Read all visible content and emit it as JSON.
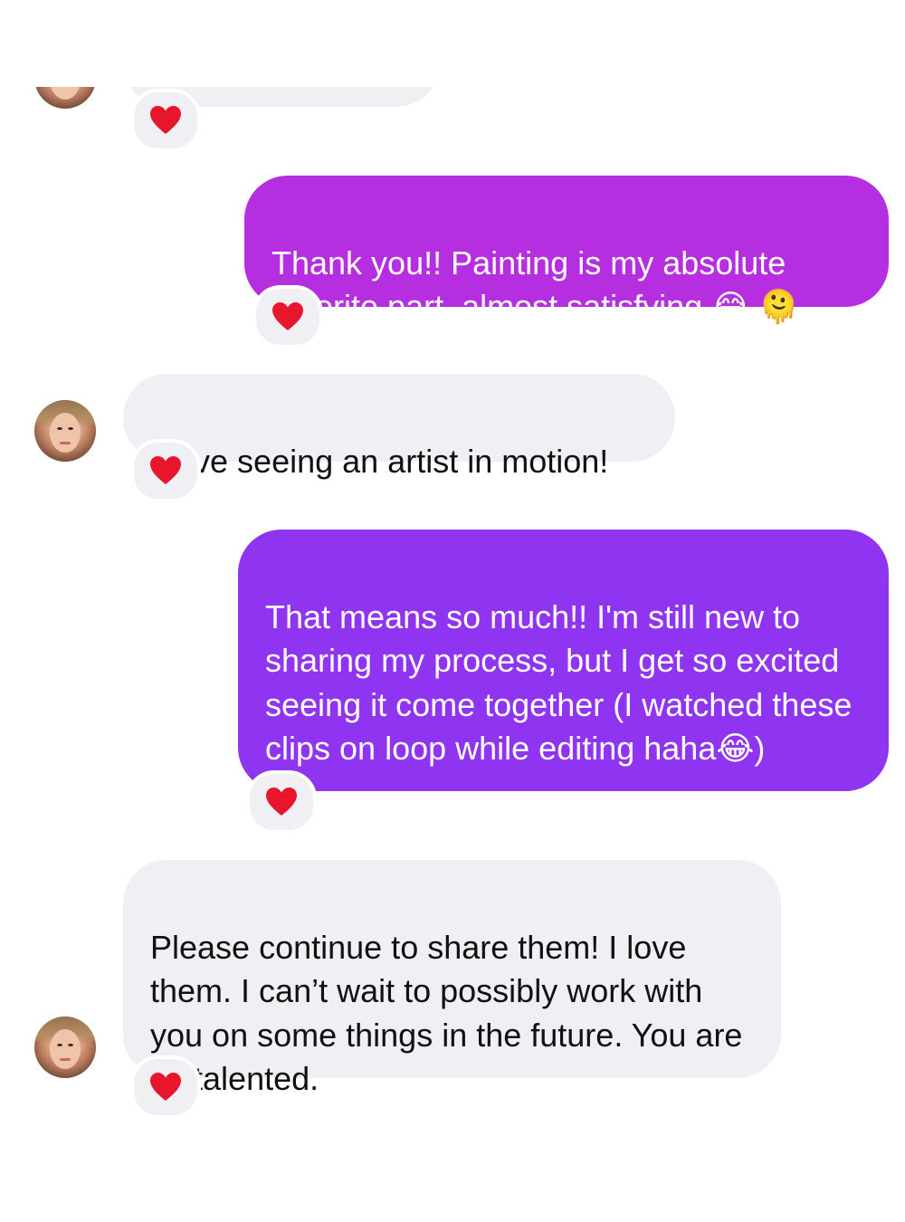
{
  "colors": {
    "incoming_bubble": "#efeff4",
    "outgoing_bubble_1": "#b52fe0",
    "outgoing_bubble_2": "#8f34f0",
    "heart": "#e8162c"
  },
  "messages": [
    {
      "direction": "incoming",
      "text": "",
      "reaction": "heart-icon"
    },
    {
      "direction": "outgoing",
      "text": "Thank you!! Painting is my absolute favorite part, almost satisfying 😂 🫠",
      "reaction": "heart-icon"
    },
    {
      "direction": "incoming",
      "text": "I love seeing an artist in motion!",
      "reaction": "heart-icon"
    },
    {
      "direction": "outgoing",
      "text": "That means so much!! I'm still new to sharing my process, but I get so excited seeing it come together (I watched these clips on loop while editing haha😂)",
      "reaction": "heart-icon"
    },
    {
      "direction": "incoming",
      "text": "Please continue to share them! I love them. I can’t wait to possibly work with you on some things in the future. You are so talented.",
      "reaction": "heart-icon"
    }
  ]
}
